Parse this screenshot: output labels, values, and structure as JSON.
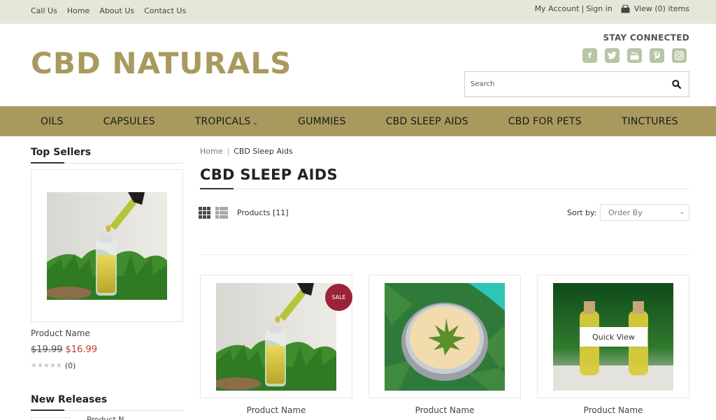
{
  "topbar": {
    "links": [
      "Call Us",
      "Home",
      "About Us",
      "Contact Us"
    ],
    "my_account": "My Account",
    "divider": "|",
    "sign_in": "Sign in",
    "cart": "View (0) items"
  },
  "header": {
    "logo": "CBD NATURALS",
    "stay_connected": "STAY CONNECTED",
    "social_icons": [
      "facebook-icon",
      "twitter-icon",
      "youtube-icon",
      "pinterest-icon",
      "instagram-icon"
    ],
    "search_placeholder": "Search"
  },
  "nav": {
    "items": [
      "OILS",
      "CAPSULES",
      "TROPICALS",
      "GUMMIES",
      "CBD SLEEP AIDS",
      "CBD FOR PETS",
      "TINCTURES"
    ]
  },
  "sidebar": {
    "top_sellers_title": "Top Sellers",
    "product": {
      "name": "Product Name",
      "old_price": "$19.99",
      "new_price": "$16.99",
      "review_count": "(0)",
      "rating_stars": 0
    },
    "new_releases_title": "New Releases",
    "new_releases_partial": "Product N..."
  },
  "main": {
    "breadcrumb_home": "Home",
    "breadcrumb_sep": "|",
    "breadcrumb_current": "CBD Sleep Aids",
    "title": "CBD SLEEP AIDS",
    "products_count": "Products [11]",
    "sort_label": "Sort by:",
    "sort_value": "Order By",
    "products": [
      {
        "name": "Product Name",
        "badge": "SALE"
      },
      {
        "name": "Product Name"
      },
      {
        "name": "Product Name",
        "hover_button": "Quick View"
      }
    ]
  },
  "colors": {
    "brand": "#a89a5e",
    "topbar_bg": "#e3e8d9",
    "sale_badge": "#9b2237",
    "sale_price": "#c0392b",
    "social_icon_bg": "#b8c5a6"
  }
}
